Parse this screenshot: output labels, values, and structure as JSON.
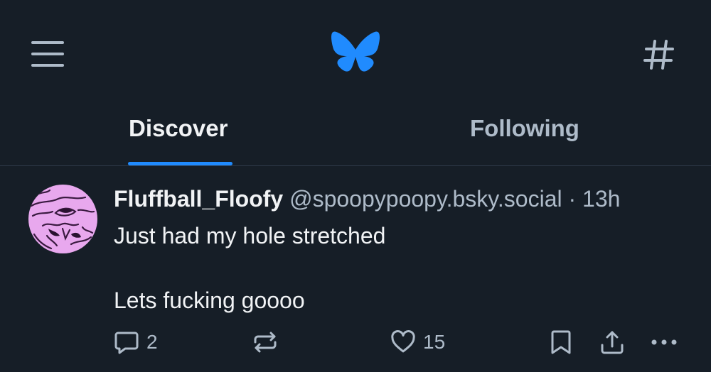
{
  "tabs": [
    {
      "label": "Discover",
      "active": true
    },
    {
      "label": "Following",
      "active": false
    }
  ],
  "icons": {
    "menu": "hamburger-menu-icon",
    "logo": "butterfly-icon",
    "feeds": "hashtag-icon",
    "reply": "speech-bubble-icon",
    "repost": "repost-arrows-icon",
    "like": "heart-icon",
    "bookmark": "bookmark-icon",
    "share": "share-icon",
    "more": "ellipsis-icon"
  },
  "colors": {
    "background": "#161e27",
    "brand": "#208bfe",
    "text_primary": "#f1f3f5",
    "text_secondary": "#aebbc9",
    "avatar_background": "#e8a8ee"
  },
  "post": {
    "author_name": "Fluffball_Floofy",
    "author_handle": "@spoopypoopy.bsky.social",
    "separator": "·",
    "time": "13h",
    "text_line1": "Just had my hole stretched",
    "text_line2": "Lets fucking goooo",
    "reply_count": "2",
    "repost_count": "",
    "like_count": "15"
  }
}
